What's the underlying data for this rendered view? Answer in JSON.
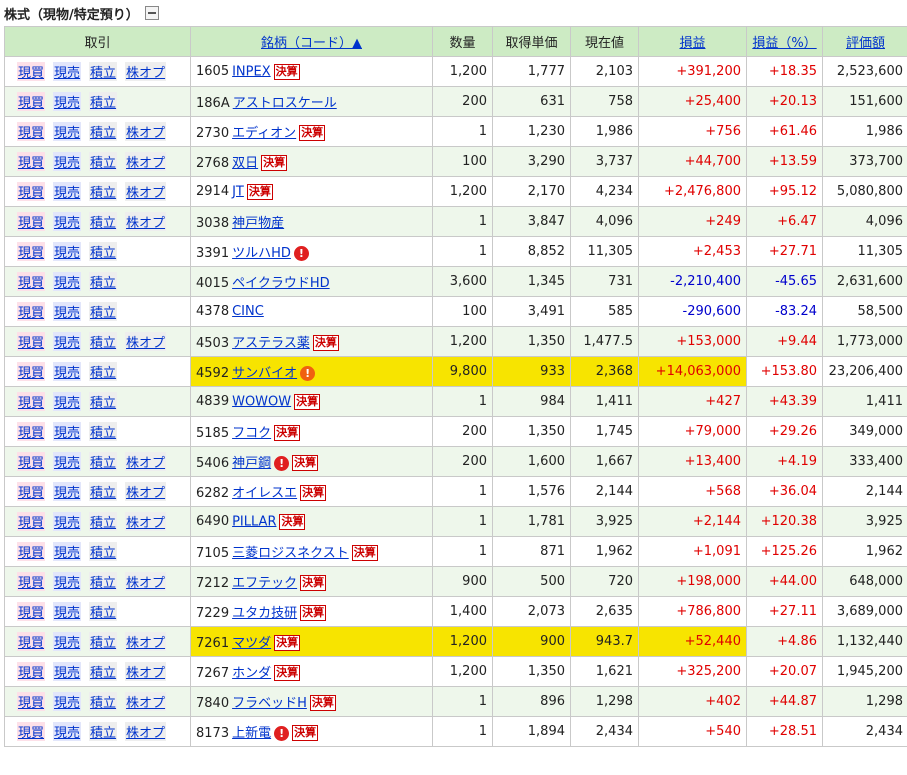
{
  "section": {
    "title": "株式（現物/特定預り）"
  },
  "headers": {
    "trade": "取引",
    "name": "銘柄（コード）▲",
    "qty": "数量",
    "cost": "取得単価",
    "price": "現在値",
    "pl": "損益",
    "plpct": "損益（%）",
    "value": "評価額"
  },
  "trade_labels": {
    "buy": "現買",
    "sell": "現売",
    "accum": "積立",
    "option": "株オプ"
  },
  "kessan_label": "決算",
  "alert_glyph": "!",
  "colors": {
    "header_bg": "#cdebc4",
    "row_alt": "#eef7eb",
    "highlight": "#f7e400",
    "positive": "#e00000",
    "negative": "#0000cc"
  },
  "rows": [
    {
      "code": "1605",
      "name": "INPEX",
      "kessan": true,
      "alert": "",
      "option": true,
      "qty": "1,200",
      "cost": "1,777",
      "price": "2,103",
      "pl": "+391,200",
      "plpct": "+18.35",
      "value": "2,523,600",
      "hl": false
    },
    {
      "code": "186A",
      "name": "アストロスケール",
      "kessan": false,
      "alert": "",
      "option": false,
      "qty": "200",
      "cost": "631",
      "price": "758",
      "pl": "+25,400",
      "plpct": "+20.13",
      "value": "151,600",
      "hl": false
    },
    {
      "code": "2730",
      "name": "エディオン",
      "kessan": true,
      "alert": "",
      "option": true,
      "qty": "1",
      "cost": "1,230",
      "price": "1,986",
      "pl": "+756",
      "plpct": "+61.46",
      "value": "1,986",
      "hl": false
    },
    {
      "code": "2768",
      "name": "双日",
      "kessan": true,
      "alert": "",
      "option": true,
      "qty": "100",
      "cost": "3,290",
      "price": "3,737",
      "pl": "+44,700",
      "plpct": "+13.59",
      "value": "373,700",
      "hl": false
    },
    {
      "code": "2914",
      "name": "JT",
      "kessan": true,
      "alert": "",
      "option": true,
      "qty": "1,200",
      "cost": "2,170",
      "price": "4,234",
      "pl": "+2,476,800",
      "plpct": "+95.12",
      "value": "5,080,800",
      "hl": false
    },
    {
      "code": "3038",
      "name": "神戸物産",
      "kessan": false,
      "alert": "",
      "option": true,
      "qty": "1",
      "cost": "3,847",
      "price": "4,096",
      "pl": "+249",
      "plpct": "+6.47",
      "value": "4,096",
      "hl": false
    },
    {
      "code": "3391",
      "name": "ツルハHD",
      "kessan": false,
      "alert": "red",
      "option": false,
      "qty": "1",
      "cost": "8,852",
      "price": "11,305",
      "pl": "+2,453",
      "plpct": "+27.71",
      "value": "11,305",
      "hl": false
    },
    {
      "code": "4015",
      "name": "ペイクラウドHD",
      "kessan": false,
      "alert": "",
      "option": false,
      "qty": "3,600",
      "cost": "1,345",
      "price": "731",
      "pl": "-2,210,400",
      "plpct": "-45.65",
      "value": "2,631,600",
      "hl": false
    },
    {
      "code": "4378",
      "name": "CINC",
      "kessan": false,
      "alert": "",
      "option": false,
      "qty": "100",
      "cost": "3,491",
      "price": "585",
      "pl": "-290,600",
      "plpct": "-83.24",
      "value": "58,500",
      "hl": false
    },
    {
      "code": "4503",
      "name": "アステラス薬",
      "kessan": true,
      "alert": "",
      "option": true,
      "qty": "1,200",
      "cost": "1,350",
      "price": "1,477.5",
      "pl": "+153,000",
      "plpct": "+9.44",
      "value": "1,773,000",
      "hl": false
    },
    {
      "code": "4592",
      "name": "サンバイオ",
      "kessan": false,
      "alert": "orange",
      "option": false,
      "qty": "9,800",
      "cost": "933",
      "price": "2,368",
      "pl": "+14,063,000",
      "plpct": "+153.80",
      "value": "23,206,400",
      "hl": true
    },
    {
      "code": "4839",
      "name": "WOWOW",
      "kessan": true,
      "alert": "",
      "option": false,
      "qty": "1",
      "cost": "984",
      "price": "1,411",
      "pl": "+427",
      "plpct": "+43.39",
      "value": "1,411",
      "hl": false
    },
    {
      "code": "5185",
      "name": "フコク",
      "kessan": true,
      "alert": "",
      "option": false,
      "qty": "200",
      "cost": "1,350",
      "price": "1,745",
      "pl": "+79,000",
      "plpct": "+29.26",
      "value": "349,000",
      "hl": false
    },
    {
      "code": "5406",
      "name": "神戸鋼",
      "kessan": true,
      "alert": "red",
      "option": true,
      "qty": "200",
      "cost": "1,600",
      "price": "1,667",
      "pl": "+13,400",
      "plpct": "+4.19",
      "value": "333,400",
      "hl": false
    },
    {
      "code": "6282",
      "name": "オイレスエ",
      "kessan": true,
      "alert": "",
      "option": true,
      "qty": "1",
      "cost": "1,576",
      "price": "2,144",
      "pl": "+568",
      "plpct": "+36.04",
      "value": "2,144",
      "hl": false
    },
    {
      "code": "6490",
      "name": "PILLAR",
      "kessan": true,
      "alert": "",
      "option": true,
      "qty": "1",
      "cost": "1,781",
      "price": "3,925",
      "pl": "+2,144",
      "plpct": "+120.38",
      "value": "3,925",
      "hl": false
    },
    {
      "code": "7105",
      "name": "三菱ロジスネクスト",
      "kessan": true,
      "alert": "",
      "option": false,
      "qty": "1",
      "cost": "871",
      "price": "1,962",
      "pl": "+1,091",
      "plpct": "+125.26",
      "value": "1,962",
      "hl": false
    },
    {
      "code": "7212",
      "name": "エフテック",
      "kessan": true,
      "alert": "",
      "option": true,
      "qty": "900",
      "cost": "500",
      "price": "720",
      "pl": "+198,000",
      "plpct": "+44.00",
      "value": "648,000",
      "hl": false
    },
    {
      "code": "7229",
      "name": "ユタカ技研",
      "kessan": true,
      "alert": "",
      "option": false,
      "qty": "1,400",
      "cost": "2,073",
      "price": "2,635",
      "pl": "+786,800",
      "plpct": "+27.11",
      "value": "3,689,000",
      "hl": false
    },
    {
      "code": "7261",
      "name": "マツダ",
      "kessan": true,
      "alert": "",
      "option": true,
      "qty": "1,200",
      "cost": "900",
      "price": "943.7",
      "pl": "+52,440",
      "plpct": "+4.86",
      "value": "1,132,440",
      "hl": true
    },
    {
      "code": "7267",
      "name": "ホンダ",
      "kessan": true,
      "alert": "",
      "option": true,
      "qty": "1,200",
      "cost": "1,350",
      "price": "1,621",
      "pl": "+325,200",
      "plpct": "+20.07",
      "value": "1,945,200",
      "hl": false
    },
    {
      "code": "7840",
      "name": "フラベッドH",
      "kessan": true,
      "alert": "",
      "option": true,
      "qty": "1",
      "cost": "896",
      "price": "1,298",
      "pl": "+402",
      "plpct": "+44.87",
      "value": "1,298",
      "hl": false
    },
    {
      "code": "8173",
      "name": "上新電",
      "kessan": true,
      "alert": "red",
      "option": true,
      "qty": "1",
      "cost": "1,894",
      "price": "2,434",
      "pl": "+540",
      "plpct": "+28.51",
      "value": "2,434",
      "hl": false
    }
  ]
}
